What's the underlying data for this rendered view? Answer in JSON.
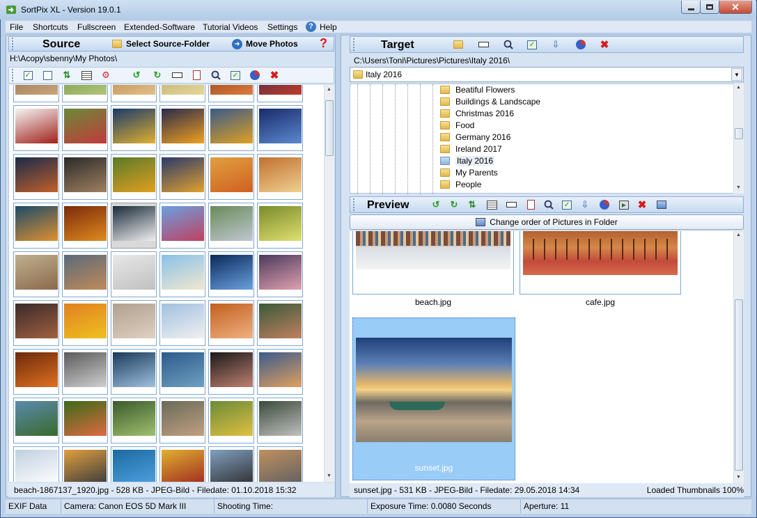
{
  "window": {
    "title": "SortPix XL - Version 19.0.1"
  },
  "menu": [
    "File",
    "Shortcuts",
    "Fullscreen",
    "Extended-Software",
    "Tutorial Videos",
    "Settings",
    "Help"
  ],
  "source": {
    "title": "Source",
    "select_folder_label": "Select Source-Folder",
    "move_photos_label": "Move Photos",
    "path": "H:\\Acopy\\sbenny\\My Photos\\",
    "status": "beach-1867137_1920.jpg - 528 KB - JPEG-Bild - Filedate: 01.10.2018 15:32"
  },
  "target": {
    "title": "Target",
    "path": "C:\\Users\\Toni\\Pictures\\Pictures\\Italy 2016\\",
    "folder_combo": "Italy 2016",
    "tree": [
      "Beatiful Flowers",
      "Buildings & Landscape",
      "Christmas 2016",
      "Food",
      "Germany 2016",
      "Ireland 2017",
      "Italy 2016",
      "My Parents",
      "People"
    ]
  },
  "preview": {
    "title": "Preview",
    "change_order_label": "Change order of Pictures in Folder",
    "items": [
      "beach.jpg",
      "cafe.jpg",
      "sunset.jpg"
    ],
    "status_left": "sunset.jpg - 531 KB - JPEG-Bild - Filedate: 29.05.2018 14:34",
    "status_right": "Loaded Thumbnails 100%"
  },
  "statusbar": {
    "exif": "EXIF Data",
    "camera": "Camera: Canon EOS 5D Mark III",
    "shooting": "Shooting Time:",
    "exposure": "Exposure Time: 0.0080 Seconds",
    "aperture": "Aperture: 11"
  },
  "colors": {
    "accent": "#2f8fd8",
    "selected": "#99ccf7",
    "red_help": "#e0141a"
  },
  "icons": [
    "check-icon",
    "uncheck-icon",
    "sort-icon",
    "grid-icon",
    "settings-icon",
    "rotate-left-icon",
    "rotate-right-icon",
    "rename-icon",
    "info-icon",
    "search-icon",
    "refresh-icon",
    "pie-icon",
    "delete-icon",
    "new-folder-icon",
    "folder-icon",
    "help-icon"
  ]
}
